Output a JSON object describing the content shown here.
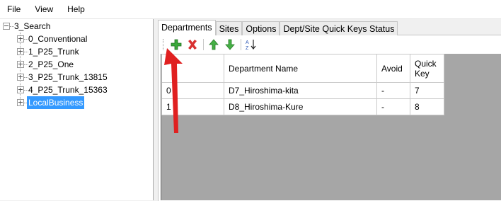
{
  "menu": [
    "File",
    "View",
    "Help"
  ],
  "tree": {
    "root": "3_Search",
    "children": [
      "0_Conventional",
      "1_P25_Trunk",
      "2_P25_One",
      "3_P25_Trunk_13815",
      "4_P25_Trunk_15363",
      "LocalBusiness"
    ]
  },
  "tabs": [
    "Departments",
    "Sites",
    "Options",
    "Dept/Site Quick Keys Status"
  ],
  "grid": {
    "headers": {
      "index": "",
      "name": "Department Name",
      "avoid": "Avoid",
      "key": "Quick Key"
    },
    "rows": [
      {
        "index": "0",
        "name": "D7_Hiroshima-kita",
        "avoid": "-",
        "key": "7"
      },
      {
        "index": "1",
        "name": "D8_Hiroshima-Kure",
        "avoid": "-",
        "key": "8"
      }
    ]
  },
  "toolbar": {
    "icons": [
      "add-icon",
      "delete-icon",
      "move-up-icon",
      "move-down-icon",
      "sort-az-icon"
    ],
    "sort_label": "A Z"
  },
  "colors": {
    "selected": "#3399ff",
    "annotation": "#e02020",
    "add": "#2f9e2f",
    "delete": "#d42a2a"
  }
}
